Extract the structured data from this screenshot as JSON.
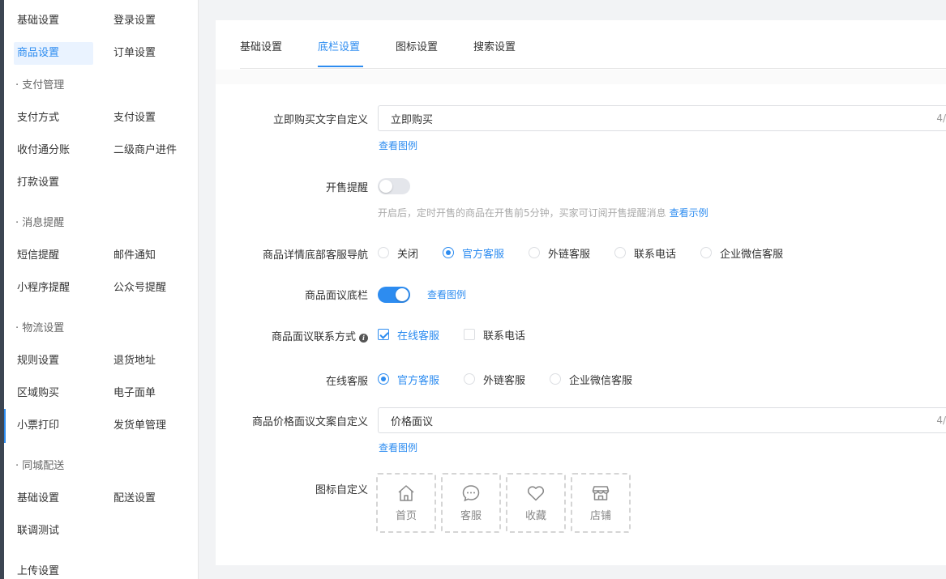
{
  "sidebar": {
    "rows": [
      {
        "c1": "基础设置",
        "c2": "登录设置"
      },
      {
        "c1": "商品设置",
        "c2": "订单设置"
      },
      {
        "c1": "支付方式",
        "c2": "支付设置"
      },
      {
        "c1": "收付通分账",
        "c2": "二级商户进件"
      },
      {
        "c1": "打款设置"
      },
      {
        "c1": "短信提醒",
        "c2": "邮件通知"
      },
      {
        "c1": "小程序提醒",
        "c2": "公众号提醒"
      },
      {
        "c1": "规则设置",
        "c2": "退货地址"
      },
      {
        "c1": "区域购买",
        "c2": "电子面单"
      },
      {
        "c1": "小票打印",
        "c2": "发货单管理"
      },
      {
        "c1": "基础设置",
        "c2": "配送设置"
      },
      {
        "c1": "联调测试"
      },
      {
        "c1": "上传设置"
      }
    ],
    "groups": [
      "· 支付管理",
      "· 消息提醒",
      "· 物流设置",
      "· 同城配送"
    ]
  },
  "tabs": [
    "基础设置",
    "底栏设置",
    "图标设置",
    "搜索设置"
  ],
  "form": {
    "buy_now": {
      "label": "立即购买文字自定义",
      "value": "立即购买",
      "counter": "4/",
      "example_link": "查看图例"
    },
    "sale_reminder": {
      "label": "开售提醒",
      "enabled": false,
      "hint": "开启后，定时开售的商品在开售前5分钟，买家可订阅开售提醒消息",
      "hint_link": "查看示例"
    },
    "service_nav": {
      "label": "商品详情底部客服导航",
      "options": [
        "关闭",
        "官方客服",
        "外链客服",
        "联系电话",
        "企业微信客服"
      ],
      "selected": "官方客服"
    },
    "negotiable_bar": {
      "label": "商品面议底栏",
      "enabled": true,
      "example_link": "查看图例"
    },
    "negotiable_contact": {
      "label": "商品面议联系方式",
      "info_icon": "i",
      "options": [
        {
          "label": "在线客服",
          "checked": true
        },
        {
          "label": "联系电话",
          "checked": false
        }
      ]
    },
    "online_service": {
      "label": "在线客服",
      "options": [
        "官方客服",
        "外链客服",
        "企业微信客服"
      ],
      "selected": "官方客服"
    },
    "price_text": {
      "label": "商品价格面议文案自定义",
      "value": "价格面议",
      "counter": "4/",
      "example_link": "查看图例"
    },
    "icon_custom": {
      "label": "图标自定义",
      "tiles": [
        {
          "icon": "home-icon",
          "label": "首页"
        },
        {
          "icon": "chat-icon",
          "label": "客服"
        },
        {
          "icon": "heart-icon",
          "label": "收藏"
        },
        {
          "icon": "store-icon",
          "label": "店铺"
        }
      ]
    }
  },
  "colors": {
    "accent": "#2d8cf0",
    "sidebar_strip": "#3c4552"
  }
}
